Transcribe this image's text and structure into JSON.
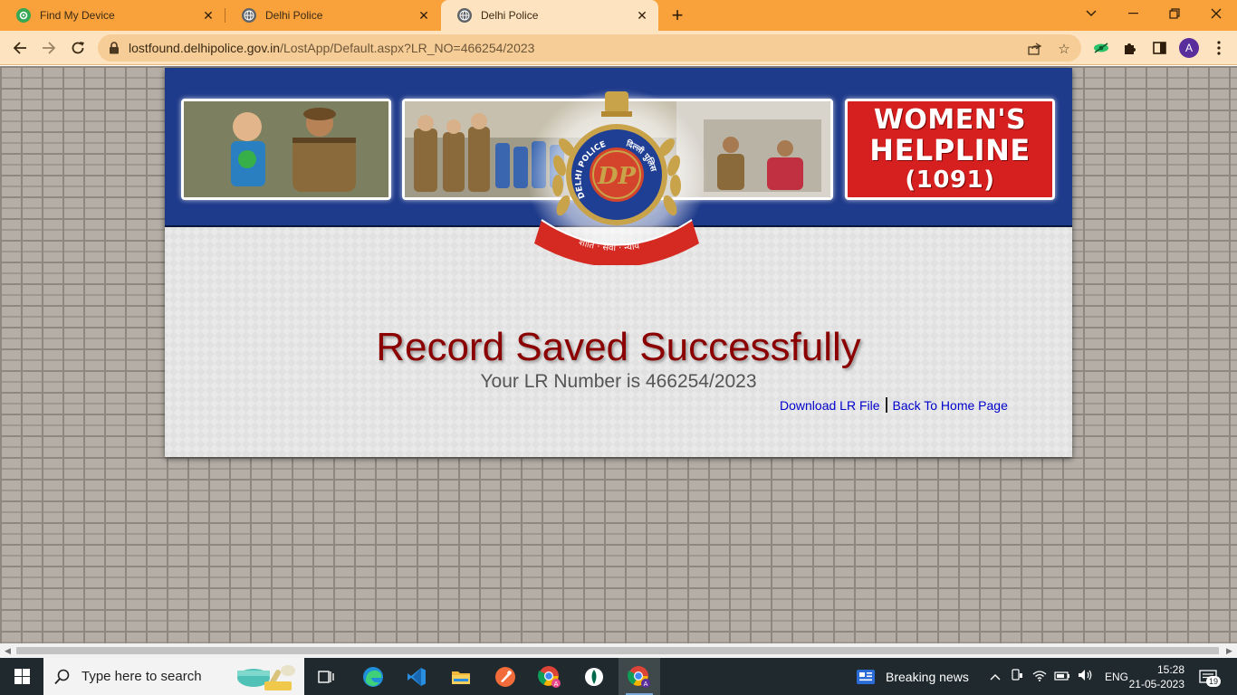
{
  "browser": {
    "tabs": [
      {
        "title": "Find My Device",
        "active": false,
        "favicon": "find-my-device-icon"
      },
      {
        "title": "Delhi Police",
        "active": false,
        "favicon": "globe-icon"
      },
      {
        "title": "Delhi Police",
        "active": true,
        "favicon": "globe-icon"
      }
    ],
    "new_tab_label": "+",
    "url_host": "lostfound.delhipolice.gov.in",
    "url_path": "/LostApp/Default.aspx?LR_NO=466254/2023",
    "profile_initial": "A",
    "accent_color": "#f9a23c"
  },
  "page": {
    "banner": {
      "helpline_line1": "WOMEN'S",
      "helpline_line2": "HELPLINE",
      "helpline_line3": "(1091)",
      "emblem_text_left": "DELHI POLICE",
      "emblem_text_right": "दिल्ली पुलिस",
      "emblem_monogram": "DP",
      "emblem_motto": "शांति · सेवा · न्याय"
    },
    "message_title": "Record Saved Successfully",
    "message_sub": "Your LR Number is 466254/2023",
    "links": {
      "download": "Download LR File",
      "home": "Back To Home Page"
    }
  },
  "taskbar": {
    "search_placeholder": "Type here to search",
    "news_label": "Breaking news",
    "language": "ENG",
    "time": "15:28",
    "date": "21-05-2023",
    "notification_count": "19"
  }
}
